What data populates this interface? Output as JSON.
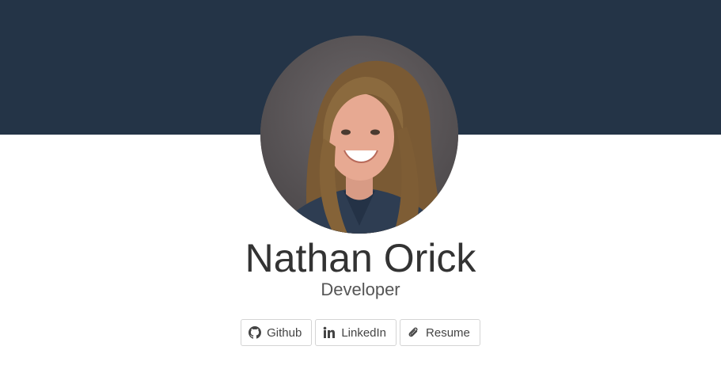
{
  "profile": {
    "name": "Nathan Orick",
    "role": "Developer"
  },
  "links": [
    {
      "label": "Github",
      "icon": "github-icon"
    },
    {
      "label": "LinkedIn",
      "icon": "linkedin-icon"
    },
    {
      "label": "Resume",
      "icon": "paperclip-icon"
    }
  ],
  "colors": {
    "banner": "#243447",
    "text": "#333333",
    "button_border": "#d4d4d4"
  }
}
